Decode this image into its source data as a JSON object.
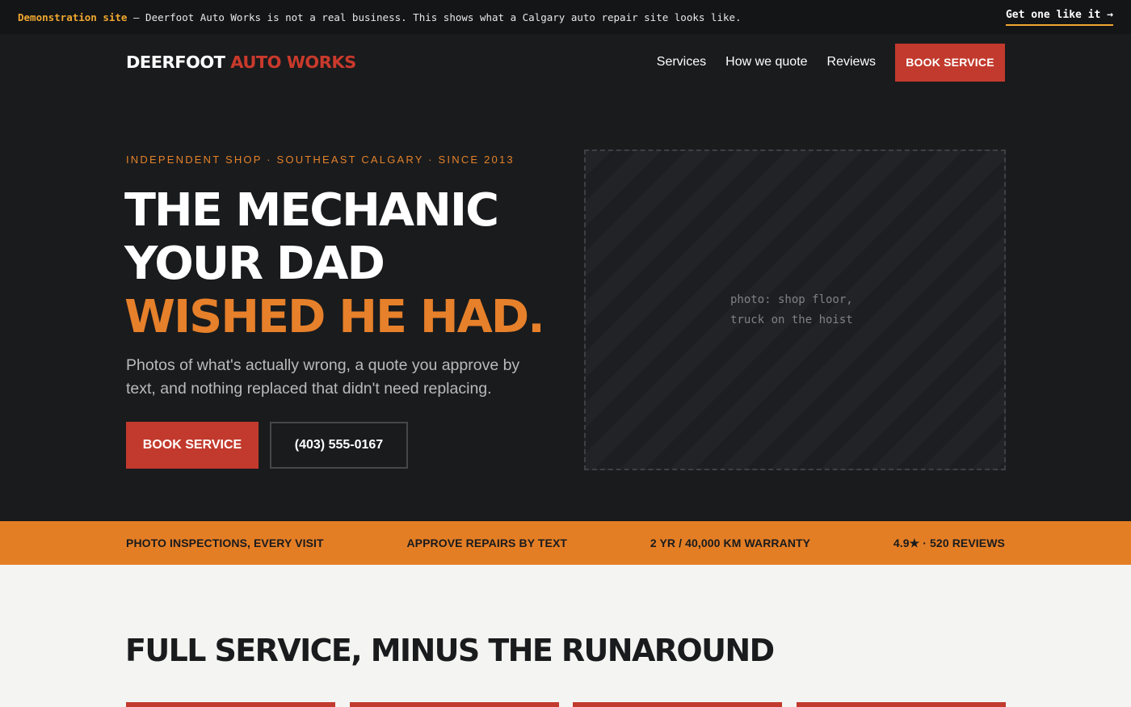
{
  "demo_bar": {
    "label": "Demonstration site",
    "message": " — Deerfoot Auto Works is not a real business. This shows what a Calgary auto repair site looks like.",
    "cta": "Get one like it →"
  },
  "nav": {
    "logo_main": "DEERFOOT ",
    "logo_accent": "AUTO WORKS",
    "links": [
      "Services",
      "How we quote",
      "Reviews"
    ],
    "book_button": "BOOK SERVICE"
  },
  "hero": {
    "eyebrow": "INDEPENDENT SHOP · SOUTHEAST CALGARY · SINCE 2013",
    "headline_line1": "THE MECHANIC",
    "headline_line2": "YOUR DAD",
    "headline_line3": "WISHED HE HAD.",
    "subtext": "Photos of what's actually wrong, a quote you approve by text, and nothing replaced that didn't need replacing.",
    "primary_button": "BOOK SERVICE",
    "phone_button": "(403) 555-0167",
    "photo_caption_line1": "photo: shop floor,",
    "photo_caption_line2": "truck on the hoist"
  },
  "trust_bar": {
    "items": [
      "PHOTO INSPECTIONS, EVERY VISIT",
      "APPROVE REPAIRS BY TEXT",
      "2 YR / 40,000 KM WARRANTY",
      "4.9★ · 520 REVIEWS"
    ]
  },
  "services": {
    "title": "FULL SERVICE, MINUS THE RUNAROUND"
  },
  "colors": {
    "accent_red": "#c23a2d",
    "accent_orange": "#e47e25",
    "demo_highlight": "#f0a830",
    "dark_bg": "#1a1b1d",
    "light_bg": "#f4f4f2"
  }
}
